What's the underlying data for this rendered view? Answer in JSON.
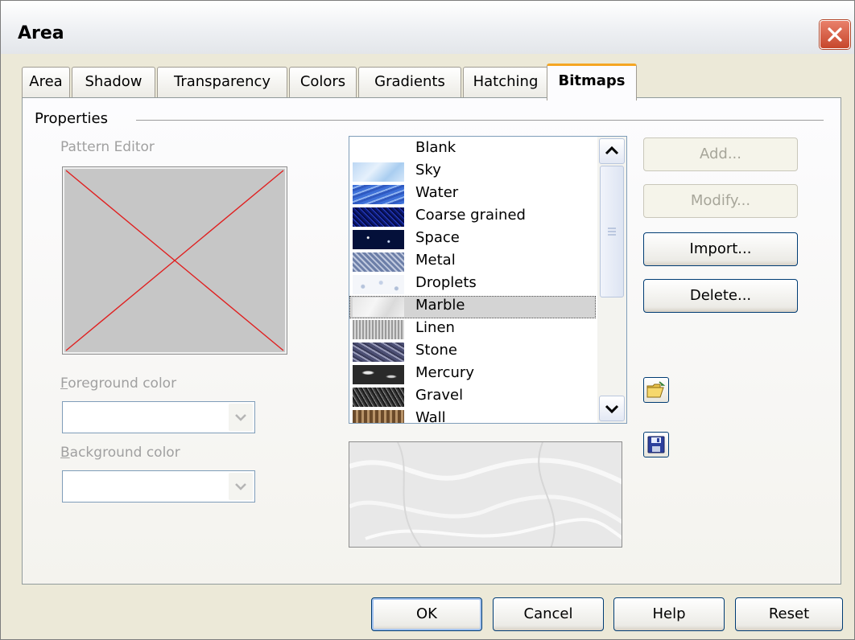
{
  "window": {
    "title": "Area"
  },
  "tabs": [
    {
      "label": "Area",
      "active": false
    },
    {
      "label": "Shadow",
      "active": false
    },
    {
      "label": "Transparency",
      "active": false
    },
    {
      "label": "Colors",
      "active": false
    },
    {
      "label": "Gradients",
      "active": false
    },
    {
      "label": "Hatching",
      "active": false
    },
    {
      "label": "Bitmaps",
      "active": true
    }
  ],
  "properties": {
    "group_label": "Properties",
    "pattern_editor_label": "Pattern Editor",
    "foreground_color_label": "Foreground color",
    "foreground_color_value": "",
    "background_color_label": "Background color",
    "background_color_value": ""
  },
  "bitmap_list": {
    "items": [
      {
        "label": "Blank",
        "icon": "blank-swatch"
      },
      {
        "label": "Sky",
        "icon": "sky-swatch"
      },
      {
        "label": "Water",
        "icon": "water-swatch"
      },
      {
        "label": "Coarse grained",
        "icon": "coarse-grained-swatch"
      },
      {
        "label": "Space",
        "icon": "space-swatch"
      },
      {
        "label": "Metal",
        "icon": "metal-swatch"
      },
      {
        "label": "Droplets",
        "icon": "droplets-swatch"
      },
      {
        "label": "Marble",
        "icon": "marble-swatch",
        "selected": true
      },
      {
        "label": "Linen",
        "icon": "linen-swatch"
      },
      {
        "label": "Stone",
        "icon": "stone-swatch"
      },
      {
        "label": "Mercury",
        "icon": "mercury-swatch"
      },
      {
        "label": "Gravel",
        "icon": "gravel-swatch"
      },
      {
        "label": "Wall",
        "icon": "wall-swatch"
      }
    ],
    "selected": "Marble"
  },
  "side_buttons": {
    "add": {
      "label": "Add...",
      "enabled": false
    },
    "modify": {
      "label": "Modify...",
      "enabled": false
    },
    "import": {
      "label": "Import...",
      "enabled": true
    },
    "delete": {
      "label": "Delete...",
      "enabled": true
    },
    "load_icon": "open-folder-icon",
    "save_icon": "floppy-disk-icon"
  },
  "footer": {
    "ok": "OK",
    "cancel": "Cancel",
    "help": "Help",
    "reset": "Reset"
  },
  "colors": {
    "close_button": "#d4563a",
    "active_tab_accent": "#f5a623",
    "dialog_bg": "#ece9d8",
    "pattern_x_line": "#e02020"
  }
}
